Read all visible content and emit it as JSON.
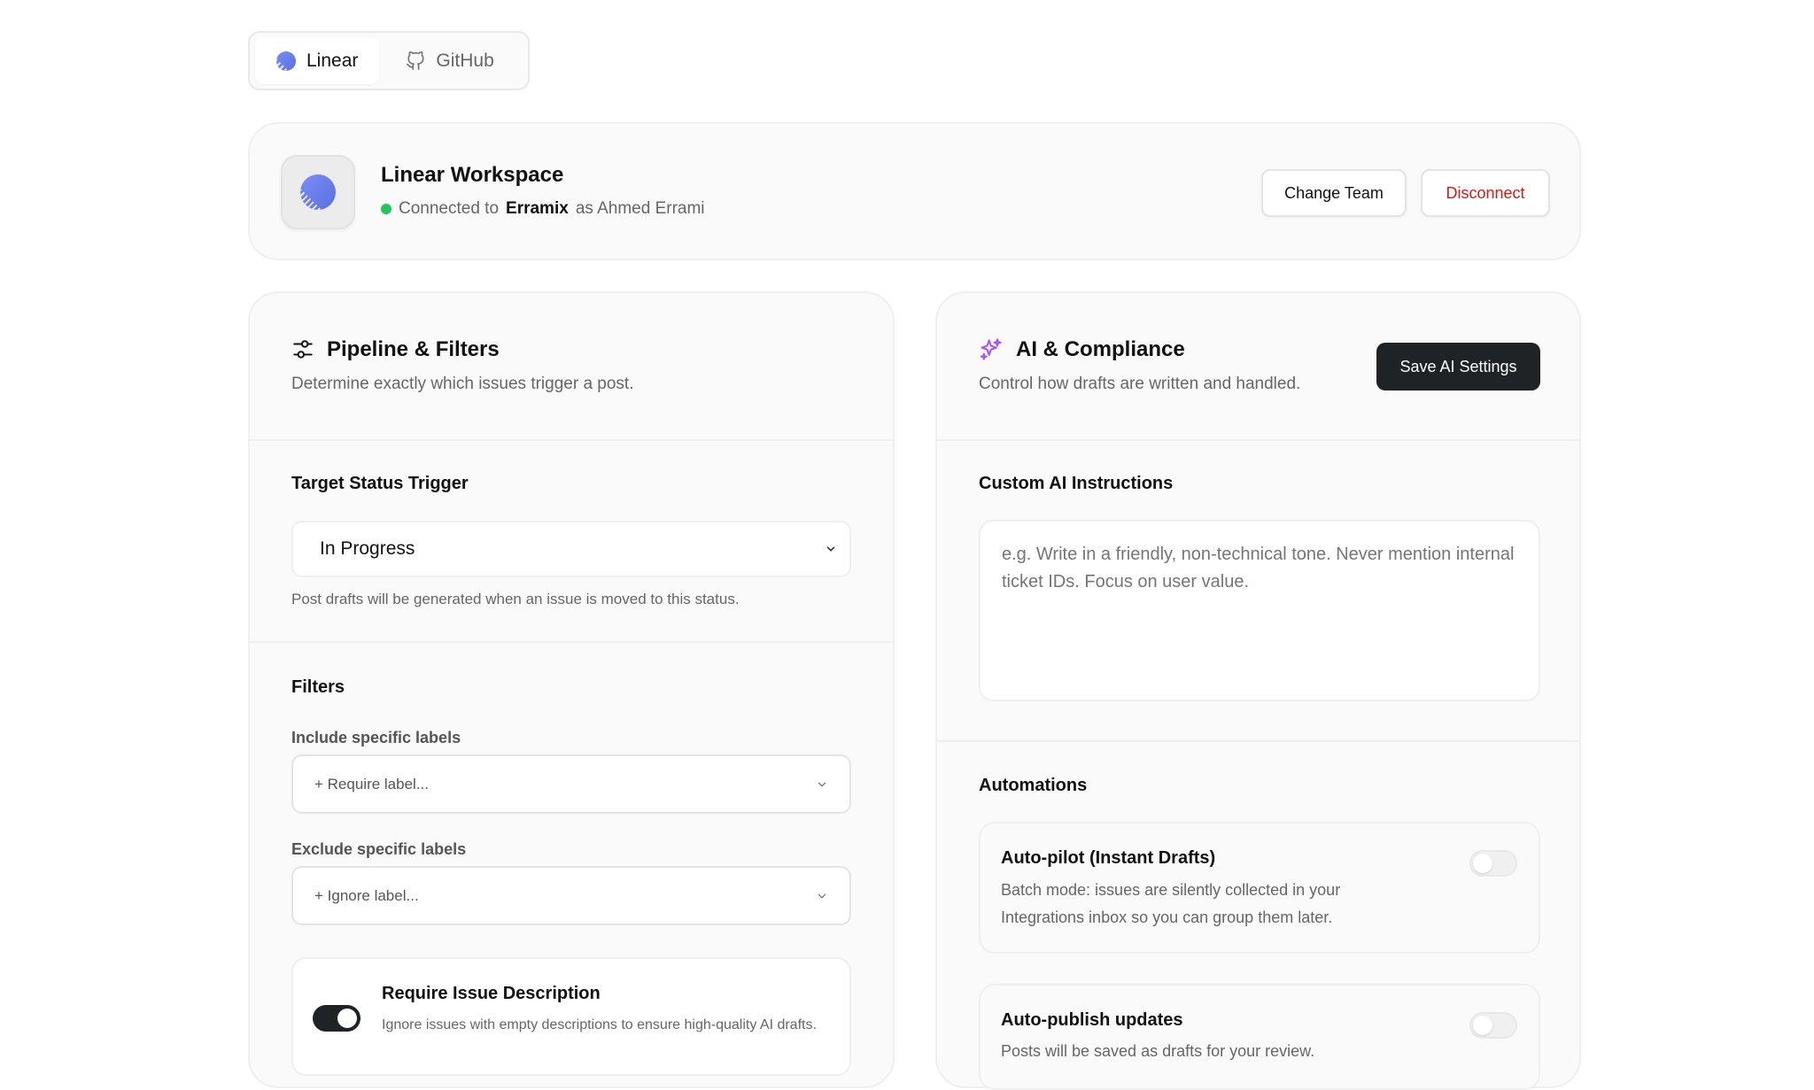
{
  "tabs": [
    {
      "label": "Linear",
      "icon": "linear-logo-icon",
      "active": true
    },
    {
      "label": "GitHub",
      "icon": "github-icon",
      "active": false
    }
  ],
  "workspace": {
    "title": "Linear Workspace",
    "status_prefix": "Connected to",
    "org": "Erramix",
    "user": "as Ahmed Errami",
    "change_team": "Change Team",
    "disconnect": "Disconnect",
    "status_color": "#22c55e"
  },
  "pipeline": {
    "title": "Pipeline & Filters",
    "subtitle": "Determine exactly which issues trigger a post.",
    "target_title": "Target Status Trigger",
    "target_value": "In Progress",
    "target_help": "Post drafts will be generated when an issue is moved to this status.",
    "filters_title": "Filters",
    "include_label": "Include specific labels",
    "include_placeholder": "+ Require label...",
    "exclude_label": "Exclude specific labels",
    "exclude_placeholder": "+ Ignore label...",
    "require_desc_title": "Require Issue Description",
    "require_desc_text": "Ignore issues with empty descriptions to ensure high-quality AI drafts.",
    "require_desc_on": true
  },
  "ai": {
    "title": "AI & Compliance",
    "subtitle": "Control how drafts are written and handled.",
    "save_label": "Save AI Settings",
    "instructions_title": "Custom AI Instructions",
    "instructions_placeholder": "e.g. Write in a friendly, non-technical tone. Never mention internal ticket IDs. Focus on user value.",
    "automations_title": "Automations",
    "autopilot_title": "Auto-pilot (Instant Drafts)",
    "autopilot_desc": "Batch mode: issues are silently collected in your Integrations inbox so you can group them later.",
    "autopilot_on": false,
    "autopublish_title": "Auto-publish updates",
    "autopublish_desc": "Posts will be saved as drafts for your review.",
    "autopublish_on": false,
    "accent": "#a855f7"
  }
}
